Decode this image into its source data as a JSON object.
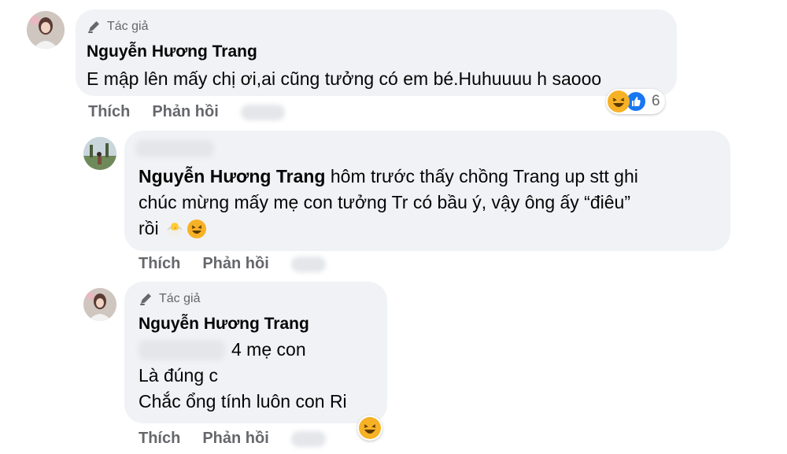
{
  "comments": [
    {
      "author_badge": "Tác giả",
      "name": "Nguyễn Hương Trang",
      "text": "E mập lên mấy chị ơi,ai cũng tưởng có em bé.Huhuuuu h saooo",
      "like_label": "Thích",
      "reply_label": "Phản hồi",
      "reaction_count": "6"
    },
    {
      "mention": "Nguyễn Hương Trang",
      "text_after_mention": " hôm trước thấy chồng Trang up stt ghi",
      "text_line2": "chúc mừng mấy mẹ con tưởng Tr có bầu ý, vậy ông ấy “điêu”",
      "text_line3": "rồi",
      "like_label": "Thích",
      "reply_label": "Phản hồi"
    },
    {
      "author_badge": "Tác giả",
      "name": "Nguyễn Hương Trang",
      "line1_suffix": "4 mẹ con",
      "line2": "Là đúng c",
      "line3": "Chắc ổng tính luôn con Ri",
      "like_label": "Thích",
      "reply_label": "Phản hồi"
    }
  ],
  "icons": {
    "author": "pencil-author-icon",
    "reactions": [
      "haha-icon",
      "like-icon"
    ],
    "inline_emojis": [
      "chick-icon",
      "grinning-squint-icon"
    ]
  },
  "colors": {
    "bubble": "#f0f2f5",
    "secondary_text": "#65676b",
    "like_blue": "#1877f2",
    "haha_yellow": "#f7b125"
  }
}
